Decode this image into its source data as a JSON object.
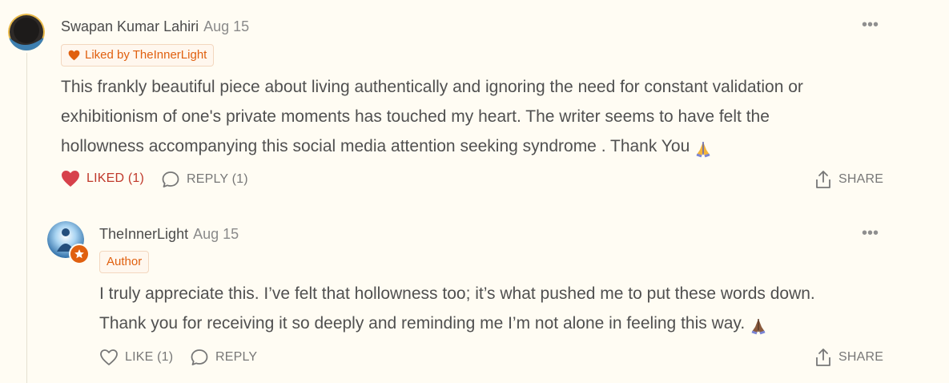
{
  "thread": [
    {
      "author": "Swapan Kumar Lahiri",
      "date": "Aug 15",
      "badge": "Liked by TheInnerLight",
      "body_lines": [
        "This frankly beautiful piece about living authentically and ignoring the need for constant validation or",
        "exhibitionism of one's private moments has touched my heart. The writer seems to have felt the",
        "hollowness accompanying this social media attention seeking syndrome . Thank You"
      ],
      "actions": {
        "like": "LIKED (1)",
        "reply": "REPLY (1)",
        "share": "SHARE"
      }
    },
    {
      "author": "TheInnerLight",
      "date": "Aug 15",
      "badge": "Author",
      "body_lines": [
        "I truly appreciate this. I’ve felt that hollowness too; it’s what pushed me to put these words down.",
        "Thank you for receiving it so deeply and reminding me I’m not alone in feeling this way."
      ],
      "actions": {
        "like": "LIKE (1)",
        "reply": "REPLY",
        "share": "SHARE"
      }
    }
  ],
  "more_glyph": "•••",
  "colors": {
    "background": "#fffcf3",
    "accent": "#e0600f",
    "liked": "#d7414b"
  }
}
